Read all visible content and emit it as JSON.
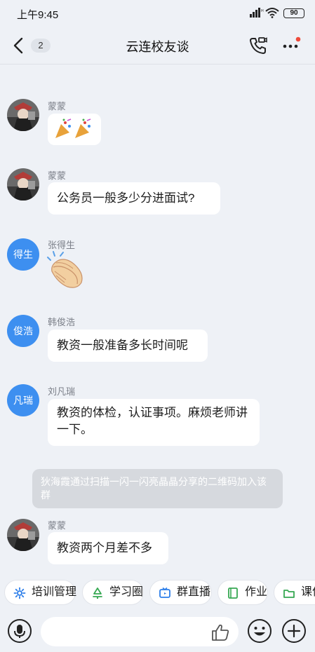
{
  "status_bar": {
    "time": "上午9:45",
    "battery": "90"
  },
  "header": {
    "title": "云连校友谈",
    "unread_count": "2"
  },
  "messages": [
    {
      "sender": "蒙蒙",
      "avatar_text": "",
      "type": "sticker",
      "text": ""
    },
    {
      "sender": "蒙蒙",
      "avatar_text": "",
      "type": "text",
      "text": "公务员一般多少分进面试?"
    },
    {
      "sender": "张得生",
      "avatar_text": "得生",
      "type": "sticker",
      "text": ""
    },
    {
      "sender": "韩俊浩",
      "avatar_text": "俊浩",
      "type": "text",
      "text": "教资一般准备多长时间呢"
    },
    {
      "sender": "刘凡瑞",
      "avatar_text": "凡瑞",
      "type": "text",
      "text": "教资的体检，认证事项。麻烦老师讲一下。"
    },
    {
      "sender": "蒙蒙",
      "avatar_text": "",
      "type": "text",
      "text": "教资两个月差不多"
    }
  ],
  "system_notice": "狄海霞通过扫描一闪一闪亮晶晶分享的二维码加入该群",
  "quick_actions": [
    "培训管理",
    "学习圈",
    "群直播",
    "作业",
    "课件"
  ],
  "input": {
    "placeholder": ""
  },
  "colors": {
    "accent": "#3d8ff0",
    "background": "#eef1f6",
    "notify_dot": "#ee4b3b"
  }
}
